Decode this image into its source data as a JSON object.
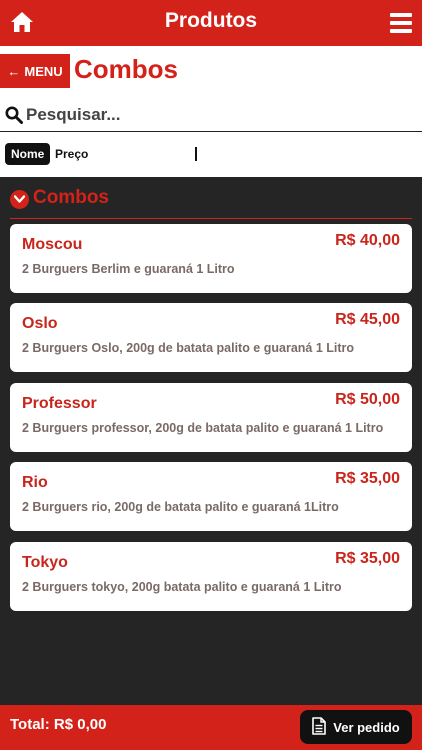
{
  "topbar": {
    "title": "Produtos",
    "home_icon": "home-icon",
    "menu_icon": "hamburger-menu-icon"
  },
  "header": {
    "menu_button": "MENU",
    "page_title": "Combos"
  },
  "search": {
    "placeholder": "Pesquisar..."
  },
  "sort": {
    "nome": "Nome",
    "preco": "Preço"
  },
  "section": {
    "title": "Combos"
  },
  "items": [
    {
      "name": "Moscou",
      "price": "R$ 40,00",
      "desc": "2 Burguers Berlim e guaraná 1 Litro"
    },
    {
      "name": "Oslo",
      "price": "R$ 45,00",
      "desc": "2 Burguers Oslo, 200g de batata palito e guaraná 1 Litro"
    },
    {
      "name": "Professor",
      "price": "R$ 50,00",
      "desc": "2 Burguers professor, 200g de batata palito e guaraná 1 Litro"
    },
    {
      "name": "Rio",
      "price": "R$ 35,00",
      "desc": "2 Burguers rio, 200g de batata palito e guaraná 1Litro"
    },
    {
      "name": "Tokyo",
      "price": "R$ 35,00",
      "desc": "2 Burguers tokyo, 200g batata palito e guaraná 1 Litro"
    }
  ],
  "footer": {
    "total": "Total: R$ 0,00",
    "ver_pedido": "Ver pedido"
  },
  "colors": {
    "primary": "#d3221a",
    "background_dark": "#252525",
    "card": "#ffffff",
    "button_dark": "#111111"
  }
}
